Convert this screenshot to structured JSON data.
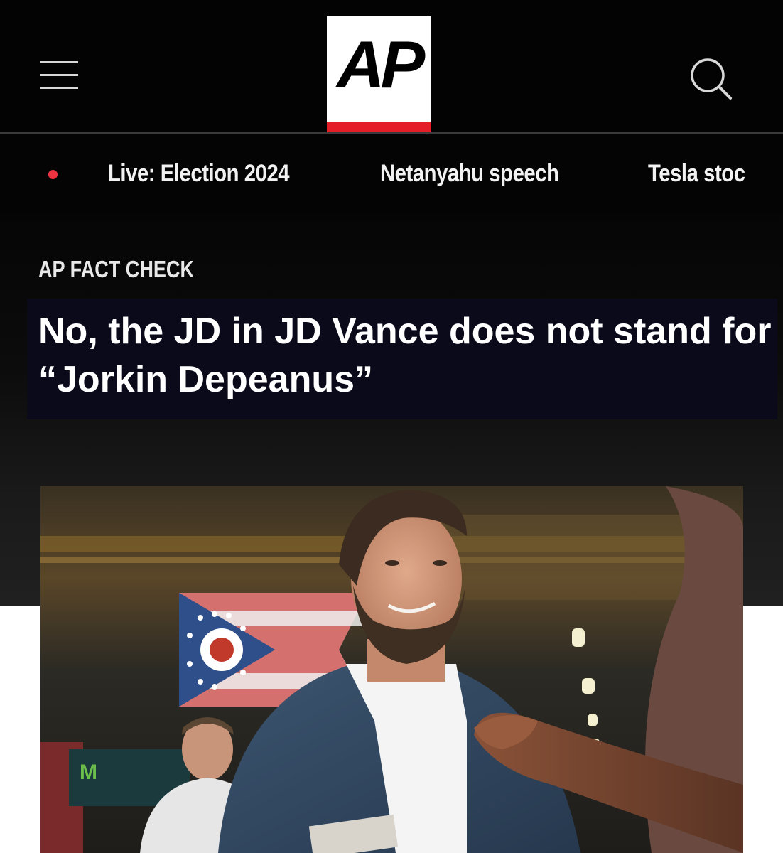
{
  "header": {
    "logo_text": "AP",
    "menu_icon": "hamburger-menu-icon",
    "search_icon": "search-icon",
    "accent_color": "#e41d27"
  },
  "nav": {
    "live_indicator_color": "#ef3340",
    "items": [
      {
        "label": "Live: Election 2024"
      },
      {
        "label": "Netanyahu speech"
      },
      {
        "label": "Tesla stoc"
      }
    ]
  },
  "article": {
    "kicker": "AP FACT CHECK",
    "headline": "No, the JD in JD Vance does not stand for “Jorkin Depeanus”",
    "photo": {
      "semantic": "photo of a smiling bearded man in a blue blazer shaking hands at a rally in front of an Ohio flag"
    }
  }
}
